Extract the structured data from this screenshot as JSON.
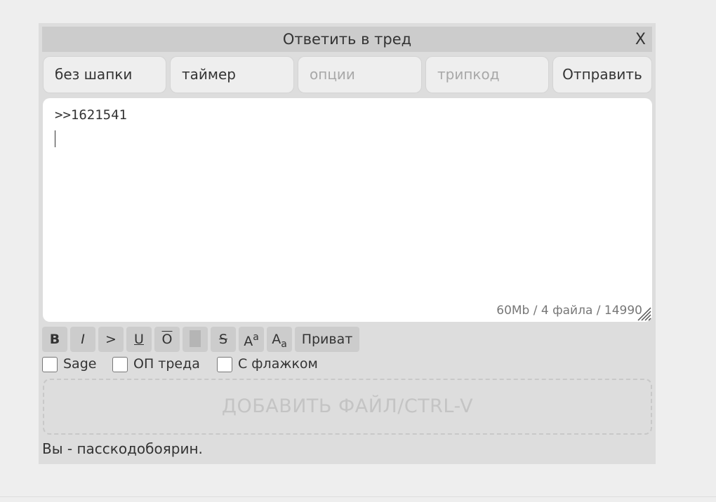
{
  "form": {
    "title": "Ответить в тред",
    "close_label": "X"
  },
  "fields": {
    "subject_value": "без шапки",
    "timer_value": "таймер",
    "options_placeholder": "опции",
    "tripcode_placeholder": "трипкод",
    "submit_label": "Отправить"
  },
  "message": {
    "value": ">>1621541",
    "limits": "60Mb / 4 файла / 14990"
  },
  "toolbar": {
    "bold": "B",
    "italic": "I",
    "quote": ">",
    "underline": "U",
    "overline": "O",
    "spoiler": "",
    "strike": "S",
    "sup_base": "A",
    "sup_mark": "a",
    "sub_base": "A",
    "sub_mark": "a",
    "private": "Приват"
  },
  "checkboxes": {
    "sage": "Sage",
    "op": "ОП треда",
    "flag": "С флажком"
  },
  "dropzone": {
    "label": "ДОБАВИТЬ ФАЙЛ/CTRL-V"
  },
  "status": {
    "text": "Вы - пасскодобоярин."
  }
}
